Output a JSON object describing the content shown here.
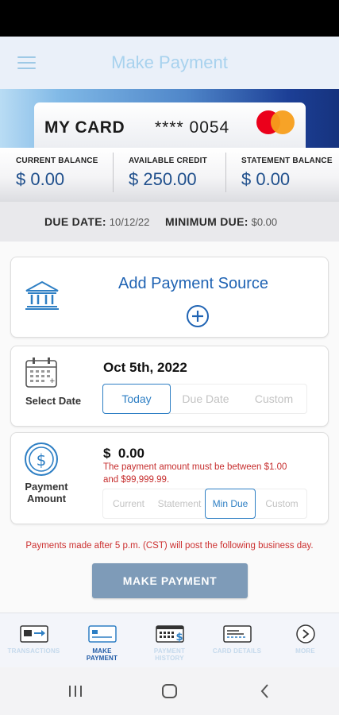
{
  "header": {
    "title": "Make Payment"
  },
  "card": {
    "name": "MY CARD",
    "masked_number": "**** 0054",
    "brand_icon": "mastercard-logo"
  },
  "balances": [
    {
      "label": "CURRENT BALANCE",
      "value": "$ 0.00"
    },
    {
      "label": "AVAILABLE CREDIT",
      "value": "$ 250.00"
    },
    {
      "label": "STATEMENT BALANCE",
      "value": "$ 0.00"
    }
  ],
  "due": {
    "due_date_label": "DUE DATE:",
    "due_date_value": "10/12/22",
    "minimum_due_label": "MINIMUM DUE:",
    "minimum_due_value": "$0.00"
  },
  "payment_source": {
    "title": "Add Payment Source",
    "icon": "bank-icon",
    "add_icon": "plus-circle-icon"
  },
  "date_section": {
    "label": "Select Date",
    "date_value": "Oct 5th, 2022",
    "options": [
      "Today",
      "Due Date",
      "Custom"
    ],
    "selected": "Today"
  },
  "amount_section": {
    "label_line1": "Payment",
    "label_line2": "Amount",
    "amount_value": "$  0.00",
    "error_line1": "The payment amount must be between $1.00",
    "error_line2": "and $99,999.99.",
    "options": [
      "Current",
      "Statement",
      "Min Due",
      "Custom"
    ],
    "selected": "Min Due"
  },
  "notice": "Payments made after 5 p.m. (CST) will post the following business day.",
  "make_payment_button": "MAKE PAYMENT",
  "bottom_nav": [
    {
      "label": "TRANSACTIONS",
      "icon": "transactions-icon",
      "active": false
    },
    {
      "label_line1": "MAKE",
      "label_line2": "PAYMENT",
      "icon": "make-payment-icon",
      "active": true
    },
    {
      "label_line1": "PAYMENT",
      "label_line2": "HISTORY",
      "icon": "payment-history-icon",
      "active": false
    },
    {
      "label": "CARD DETAILS",
      "icon": "card-details-icon",
      "active": false
    },
    {
      "label": "MORE",
      "icon": "more-chevron-icon",
      "active": false
    }
  ],
  "colors": {
    "accent": "#1f63b3",
    "error": "#c62d2d",
    "button": "#7e9bb8",
    "nav_active": "#1f5aa6"
  }
}
